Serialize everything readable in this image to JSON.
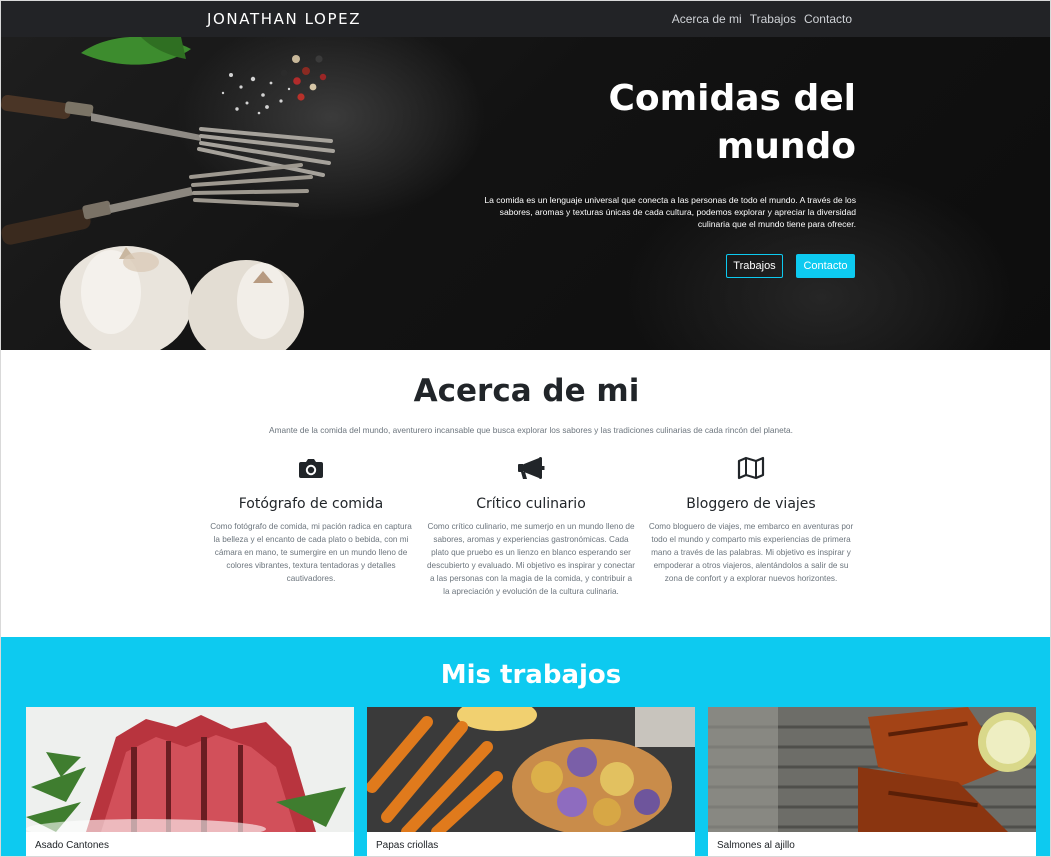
{
  "navbar": {
    "brand": "JONATHAN LOPEZ",
    "links": [
      "Acerca de mi",
      "Trabajos",
      "Contacto"
    ]
  },
  "hero": {
    "title": "Comidas del mundo",
    "text": "La comida es un lenguaje universal que conecta a las personas de todo el mundo. A través de los sabores, aromas y texturas únicas de cada cultura, podemos explorar y apreciar la diversidad culinaria que el mundo tiene para ofrecer.",
    "button_primary": "Trabajos",
    "button_secondary": "Contacto"
  },
  "about": {
    "title": "Acerca de mi",
    "subtitle": "Amante de la comida del mundo, aventurero incansable que busca explorar los sabores y las tradiciones culinarias de cada rincón del planeta.",
    "features": [
      {
        "icon": "camera-icon",
        "title": "Fotógrafo de comida",
        "text": "Como fotógrafo de comida, mi pación radica en captura la belleza y el encanto de cada plato o bebida, con mi cámara en mano, te sumergire en un mundo lleno de colores vibrantes, textura tentadoras y detalles cautivadores."
      },
      {
        "icon": "megaphone-icon",
        "title": "Crítico culinario",
        "text": "Como crítico culinario, me sumerjo en un mundo lleno de sabores, aromas y experiencias gastronómicas. Cada plato que pruebo es un lienzo en blanco esperando ser descubierto y evaluado. Mi objetivo es inspirar y conectar a las personas con la magia de la comida, y contribuir a la apreciación y evolución de la cultura culinaria."
      },
      {
        "icon": "map-icon",
        "title": "Bloggero de viajes",
        "text": "Como bloguero de viajes, me embarco en aventuras por todo el mundo y comparto mis experiencias de primera mano a través de las palabras. Mi objetivo es inspirar y empoderar a otros viajeros, alentándolos a salir de su zona de confort y a explorar nuevos horizontes."
      }
    ]
  },
  "works": {
    "title": "Mis trabajos",
    "cards": [
      {
        "caption": "Asado Cantones"
      },
      {
        "caption": "Papas criollas"
      },
      {
        "caption": "Salmones al ajillo"
      }
    ]
  },
  "colors": {
    "accent": "#0dcaf0",
    "navbar": "#222326",
    "text": "#212529",
    "muted": "#6c757d"
  }
}
